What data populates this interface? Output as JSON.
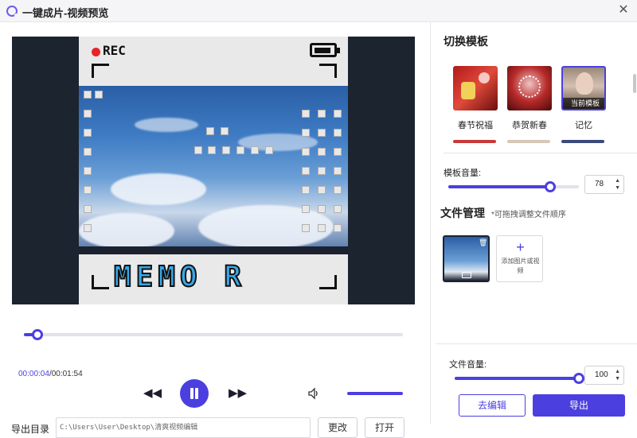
{
  "window": {
    "title": "一键成片-视频预览"
  },
  "preview": {
    "overlay_rec": "REC",
    "overlay_memo": "MEMO R"
  },
  "player": {
    "current_time": "00:00:04",
    "total_time": "/00:01:54",
    "progress": 0.035,
    "volume": 1.0
  },
  "export": {
    "label": "导出目录",
    "path": "C:\\Users\\User\\Desktop\\清爽视频编辑",
    "change_label": "更改",
    "open_label": "打开"
  },
  "templates": {
    "title": "切换模板",
    "items": [
      {
        "label": "春节祝福"
      },
      {
        "label": "恭贺新春"
      },
      {
        "label": "记忆",
        "badge": "当前模板"
      }
    ]
  },
  "template_volume": {
    "label": "模板音量:",
    "value": "78",
    "fraction": 0.78
  },
  "file_manager": {
    "title": "文件管理",
    "hint": "*可拖拽调整文件顺序",
    "add_label": "添加图片或视频"
  },
  "file_volume": {
    "label": "文件音量:",
    "value": "100",
    "fraction": 1.0
  },
  "actions": {
    "edit_label": "去编辑",
    "export_label": "导出"
  },
  "colors": {
    "accent": "#4b3fe0",
    "rec": "#e8242a"
  }
}
